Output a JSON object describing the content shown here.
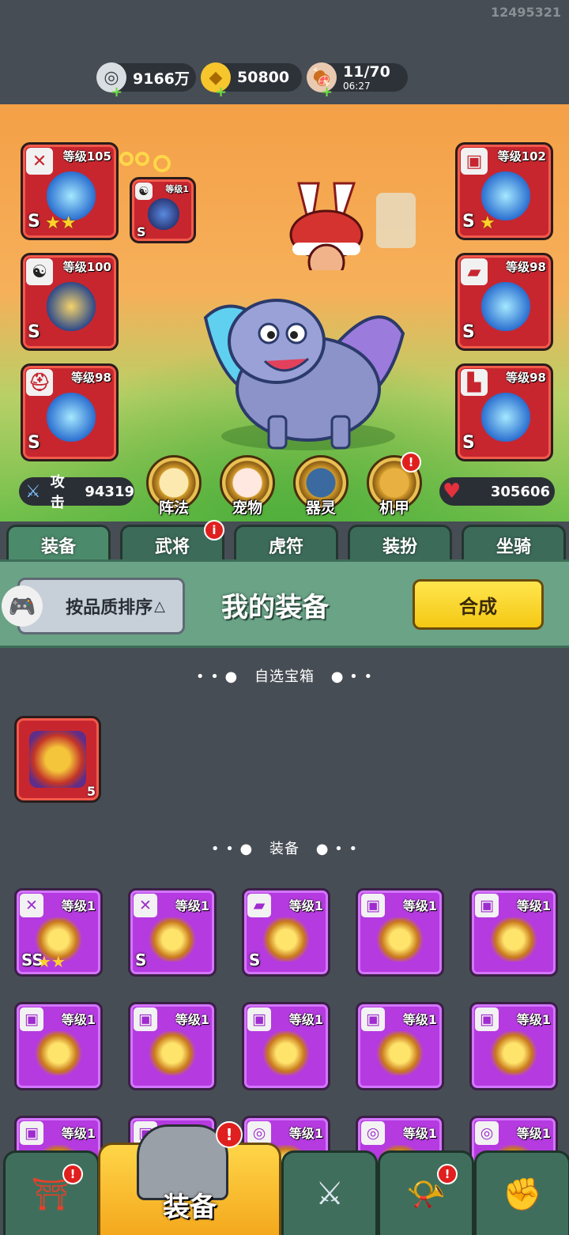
{
  "user_id": "12495321",
  "currencies": [
    {
      "icon": "silver-coin-icon",
      "value": "9166万"
    },
    {
      "icon": "gold-ingot-icon",
      "value": "50800"
    },
    {
      "icon": "meat-stamina-icon",
      "value": "11/70",
      "timer": "06:27"
    }
  ],
  "equip_slots_left": [
    {
      "icon": "sword-icon",
      "level": "等级105",
      "grade": "S",
      "stars": "★★"
    },
    {
      "icon": "yinyang-icon",
      "level": "等级100",
      "grade": "S",
      "stars": ""
    },
    {
      "icon": "helmet-icon",
      "level": "等级98",
      "grade": "S",
      "stars": ""
    }
  ],
  "equip_slots_right": [
    {
      "icon": "armor-icon",
      "level": "等级102",
      "grade": "S",
      "stars": "★"
    },
    {
      "icon": "bracer-icon",
      "level": "等级98",
      "grade": "S",
      "stars": ""
    },
    {
      "icon": "boot-icon",
      "level": "等级98",
      "grade": "S",
      "stars": ""
    }
  ],
  "linked_slot": {
    "icon": "yinyang-icon",
    "level": "等级1",
    "grade": "S"
  },
  "stats": {
    "attack_label": "攻击",
    "attack_value": "94319",
    "hp_value": "305606"
  },
  "functions": [
    "阵法",
    "宠物",
    "器灵",
    "机甲"
  ],
  "tabs": [
    "装备",
    "武将",
    "虎符",
    "装扮",
    "坐骑"
  ],
  "toolbar": {
    "sort_label": "按品质排序",
    "title": "我的装备",
    "merge_label": "合成"
  },
  "sections": {
    "chest": "自选宝箱",
    "equipment": "装备"
  },
  "chest_item": {
    "count": "5"
  },
  "items": [
    {
      "icon": "sword-icon",
      "level": "等级1",
      "grade": "SS",
      "stars": "★★"
    },
    {
      "icon": "sword-icon",
      "level": "等级1",
      "grade": "S",
      "stars": ""
    },
    {
      "icon": "bracer-icon",
      "level": "等级1",
      "grade": "S",
      "stars": ""
    },
    {
      "icon": "armor-icon",
      "level": "等级1",
      "grade": "",
      "stars": ""
    },
    {
      "icon": "armor-icon",
      "level": "等级1",
      "grade": "",
      "stars": ""
    },
    {
      "icon": "armor-icon",
      "level": "等级1",
      "grade": "",
      "stars": ""
    },
    {
      "icon": "armor-icon",
      "level": "等级1",
      "grade": "",
      "stars": ""
    },
    {
      "icon": "armor-icon",
      "level": "等级1",
      "grade": "",
      "stars": ""
    },
    {
      "icon": "armor-icon",
      "level": "等级1",
      "grade": "",
      "stars": ""
    },
    {
      "icon": "armor-icon",
      "level": "等级1",
      "grade": "",
      "stars": ""
    },
    {
      "icon": "armor-icon",
      "level": "等级1",
      "grade": "",
      "stars": ""
    },
    {
      "icon": "armor-icon",
      "level": "等级1",
      "grade": "",
      "stars": ""
    },
    {
      "icon": "necklace-icon",
      "level": "等级1",
      "grade": "",
      "stars": ""
    },
    {
      "icon": "necklace-icon",
      "level": "等级1",
      "grade": "",
      "stars": ""
    },
    {
      "icon": "necklace-icon",
      "level": "等级1",
      "grade": "",
      "stars": ""
    }
  ],
  "bottom_nav": {
    "active_label": "装备"
  }
}
